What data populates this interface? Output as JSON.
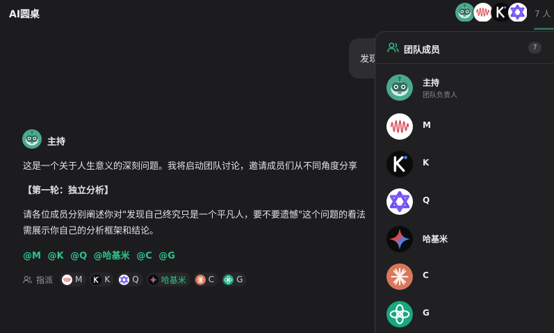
{
  "header": {
    "title": "AI圆桌",
    "member_count": "7 人"
  },
  "user_bubble": {
    "text": "发现"
  },
  "message": {
    "author": "主持",
    "line1": "这是一个关于人生意义的深刻问题。我将启动团队讨论，邀请成员们从不同角度分享",
    "line2": "【第一轮：独立分析】",
    "line3": "请各位成员分别阐述你对\"发现自己终究只是一个平凡人，要不要遗憾\"这个问题的看法",
    "line4": "需展示你自己的分析框架和结论。",
    "mentions": [
      "@M",
      "@K",
      "@Q",
      "@哈基米",
      "@C",
      "@G"
    ],
    "assign_label": "指派",
    "assignees": [
      "M",
      "K",
      "Q",
      "哈基米",
      "C",
      "G"
    ]
  },
  "panel": {
    "title": "团队成员",
    "count": "7",
    "members": [
      {
        "name": "主持",
        "role": "团队负责人",
        "icon": "host-robot-icon"
      },
      {
        "name": "M",
        "role": "",
        "icon": "wave-logo-icon"
      },
      {
        "name": "K",
        "role": "",
        "icon": "k-logo-icon"
      },
      {
        "name": "Q",
        "role": "",
        "icon": "star-logo-icon"
      },
      {
        "name": "哈基米",
        "role": "",
        "icon": "sparkle-logo-icon"
      },
      {
        "name": "C",
        "role": "",
        "icon": "burst-logo-icon"
      },
      {
        "name": "G",
        "role": "",
        "icon": "knot-logo-icon"
      }
    ]
  },
  "colors": {
    "background": "#1c1c1e",
    "panel": "#202022",
    "accent_green": "#2bc48a",
    "host_teal": "#4aa88e",
    "wave_red": "#d8414b",
    "star_purple": "#6b4df0",
    "burst_orange": "#d9775a",
    "knot_green": "#19a77f"
  }
}
